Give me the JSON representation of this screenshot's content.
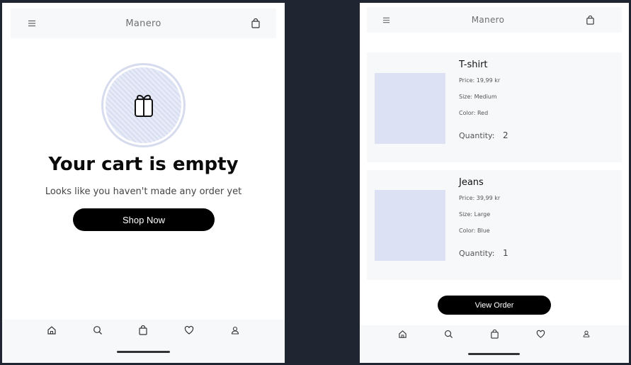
{
  "left": {
    "header": {
      "brand": "Manero",
      "menu_icon": "menu-icon",
      "bag_icon": "shopping-bag-icon"
    },
    "empty_state": {
      "icon": "gift-icon",
      "title": "Your cart is empty",
      "subtitle": "Looks like you haven't made any order yet",
      "button_label": "Shop Now"
    },
    "nav": [
      "home-icon",
      "search-icon",
      "shopping-bag-icon",
      "heart-icon",
      "profile-icon"
    ]
  },
  "right": {
    "header": {
      "brand": "Manero",
      "menu_icon": "menu-icon",
      "bag_icon": "shopping-bag-icon"
    },
    "items": [
      {
        "name": "T-shirt",
        "price": "Price: 19,99 kr",
        "size": "Size: Medium",
        "color": "Color: Red",
        "quantity_label": "Quantity:",
        "quantity": "2"
      },
      {
        "name": "Jeans",
        "price": "Price: 39,99 kr",
        "size": "Size: Large",
        "color": "Color: Blue",
        "quantity_label": "Quantity:",
        "quantity": "1"
      }
    ],
    "view_order_label": "View Order",
    "nav": [
      "home-icon",
      "search-icon",
      "shopping-bag-icon",
      "heart-icon",
      "profile-icon"
    ]
  },
  "colors": {
    "background": "#1f2631",
    "panel": "#f7f8fa",
    "image_placeholder": "#dde1f4",
    "button": "#000000"
  }
}
